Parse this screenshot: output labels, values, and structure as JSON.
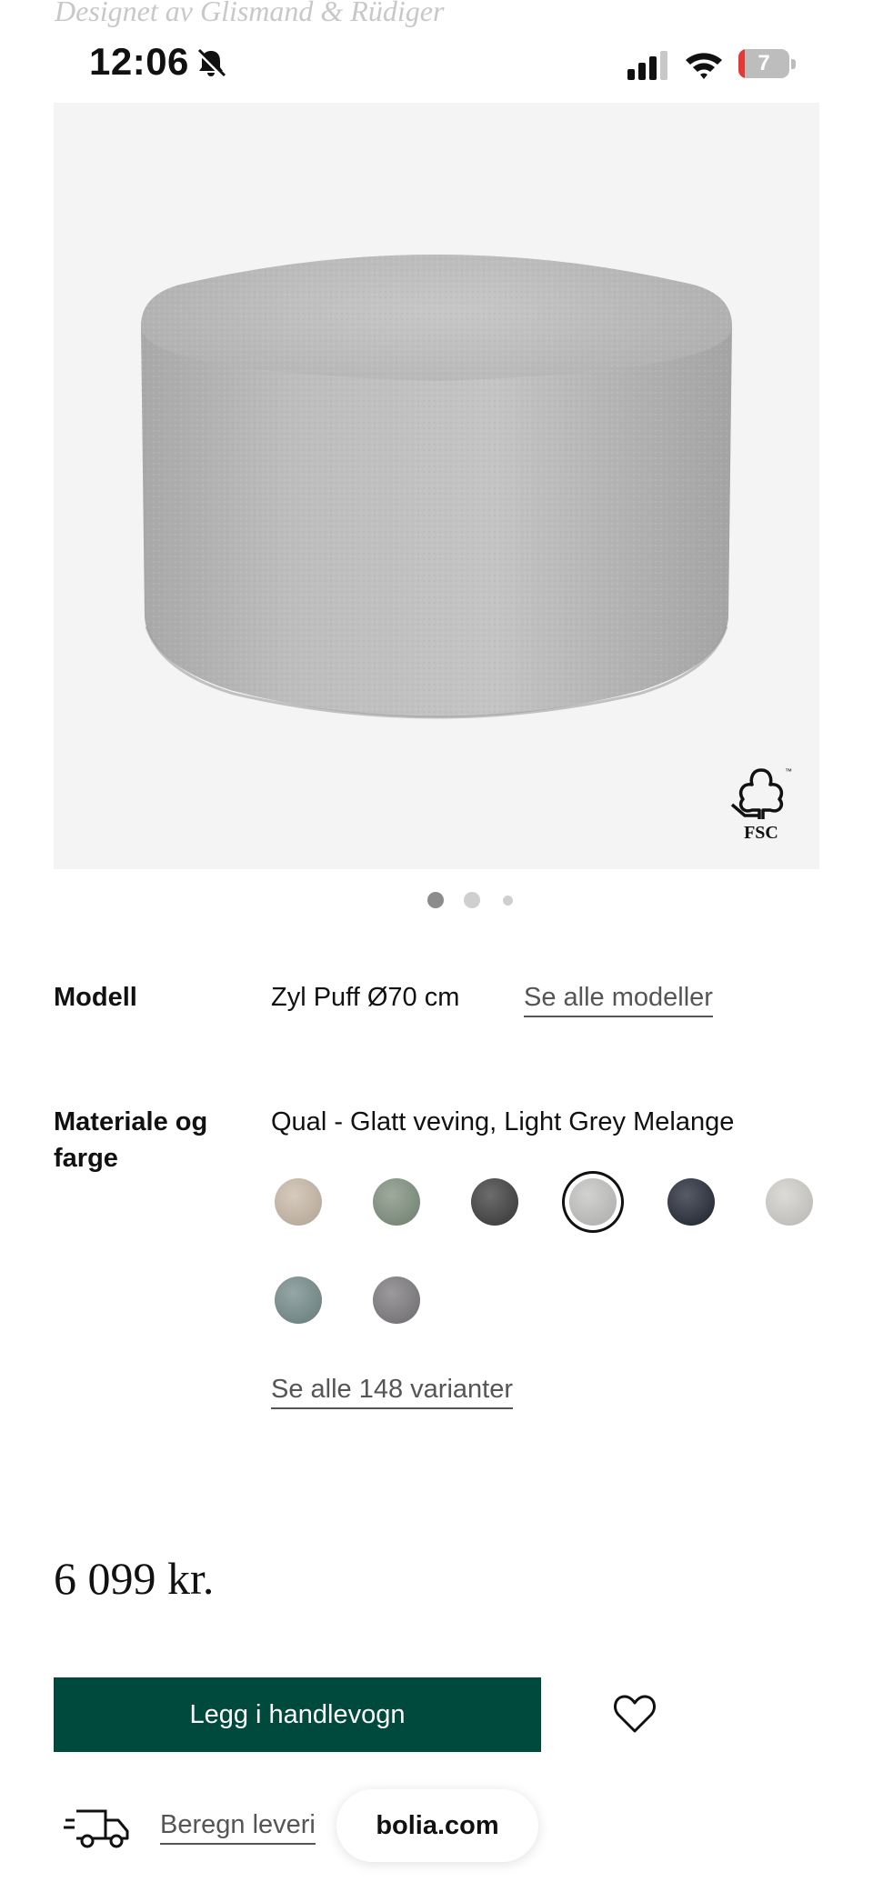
{
  "designer_text": "Designet av Glismand & Rüdiger",
  "status_bar": {
    "time": "12:06",
    "battery": "7"
  },
  "product": {
    "fsc_label": "FSC",
    "carousel_total": 3,
    "carousel_active": 1
  },
  "model": {
    "label": "Modell",
    "value": "Zyl Puff Ø70 cm",
    "link": "Se alle modeller"
  },
  "material": {
    "label": "Materiale og farge",
    "value": "Qual - Glatt veving, Light Grey Melange",
    "swatches": [
      {
        "color": "#c9b9a7",
        "selected": false
      },
      {
        "color": "#7d8e7c",
        "selected": false
      },
      {
        "color": "#3b3b3b",
        "selected": false
      },
      {
        "color": "#c2c2c0",
        "selected": true
      },
      {
        "color": "#1f2533",
        "selected": false
      },
      {
        "color": "#d0cfca",
        "selected": false
      },
      {
        "color": "#728a88",
        "selected": false
      },
      {
        "color": "#7a787c",
        "selected": false
      }
    ],
    "variants_link": "Se alle 148 varianter"
  },
  "price": "6 099 kr.",
  "cart_button": "Legg i handlevogn",
  "delivery_link": "Beregn leveri",
  "browser_url": "bolia.com",
  "colors": {
    "accent": "#004a3d",
    "image_bg": "#f4f4f4"
  }
}
